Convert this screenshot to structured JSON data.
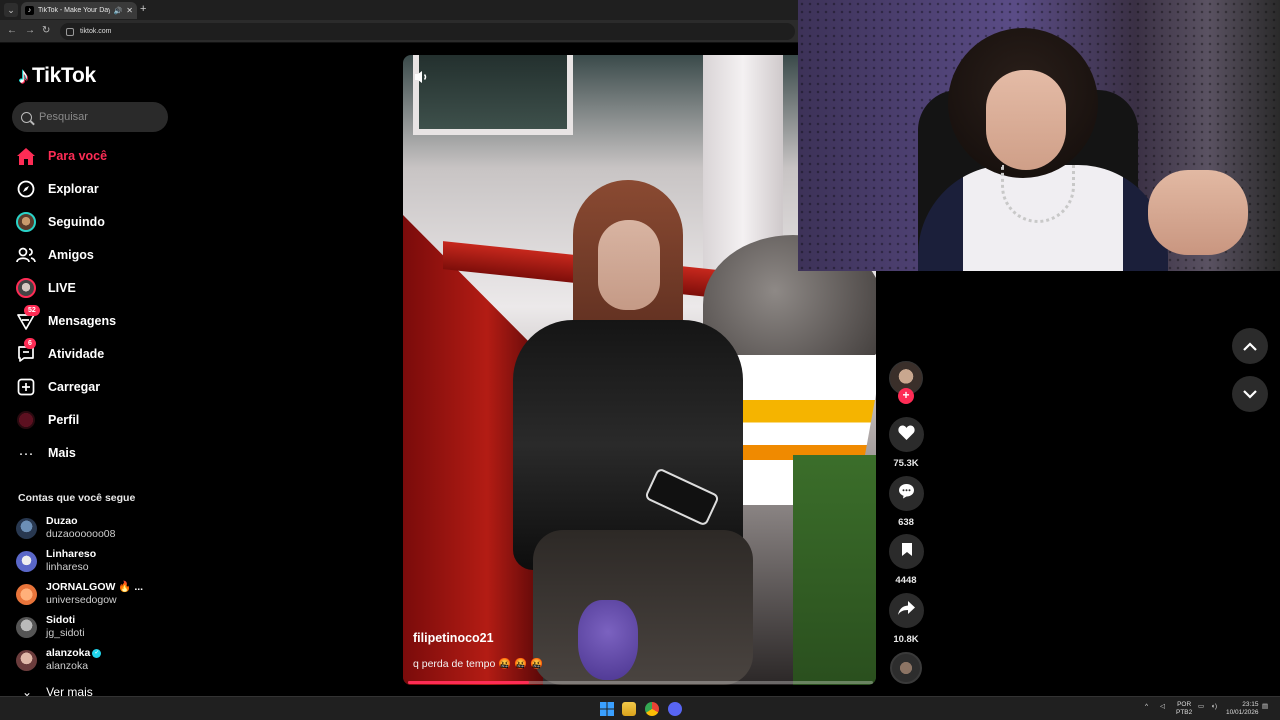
{
  "browser": {
    "tab_title": "TikTok - Make Your Day",
    "url": "tiktok.com"
  },
  "sidebar": {
    "logo_text": "TikTok",
    "search_placeholder": "Pesquisar",
    "nav": [
      {
        "label": "Para você",
        "icon": "home-icon",
        "active": true
      },
      {
        "label": "Explorar",
        "icon": "compass-icon"
      },
      {
        "label": "Seguindo",
        "icon": "following-avatar"
      },
      {
        "label": "Amigos",
        "icon": "friends-icon"
      },
      {
        "label": "LIVE",
        "icon": "live-avatar"
      },
      {
        "label": "Mensagens",
        "icon": "messages-icon",
        "badge": "52"
      },
      {
        "label": "Atividade",
        "icon": "activity-icon",
        "badge": "6"
      },
      {
        "label": "Carregar",
        "icon": "upload-icon"
      },
      {
        "label": "Perfil",
        "icon": "profile-avatar"
      },
      {
        "label": "Mais",
        "icon": "more-icon"
      }
    ],
    "following_header": "Contas que você segue",
    "following": [
      {
        "name": "Duzao",
        "handle": "duzaoooooo08"
      },
      {
        "name": "Linhareso",
        "handle": "linhareso"
      },
      {
        "name": "JORNALGOW 🔥 ...",
        "handle": "universedogow"
      },
      {
        "name": "Sidoti",
        "handle": "jg_sidoti"
      },
      {
        "name": "alanzoka",
        "handle": "alanzoka",
        "verified": true
      }
    ],
    "see_more": "Ver mais"
  },
  "video": {
    "username": "filipetinoco21",
    "caption": "q perda de tempo 🤬 🤬 🤬",
    "progress": 0.26,
    "likes": "75.3K",
    "comments": "638",
    "saves": "4448",
    "shares": "10.8K"
  },
  "taskbar": {
    "lang_top": "POR",
    "lang_bottom": "PTB2",
    "time": "23:15",
    "date": "10/01/2026"
  },
  "colors": {
    "accent": "#fe2c55",
    "background": "#000000",
    "button_bg": "#2b2b2b"
  }
}
